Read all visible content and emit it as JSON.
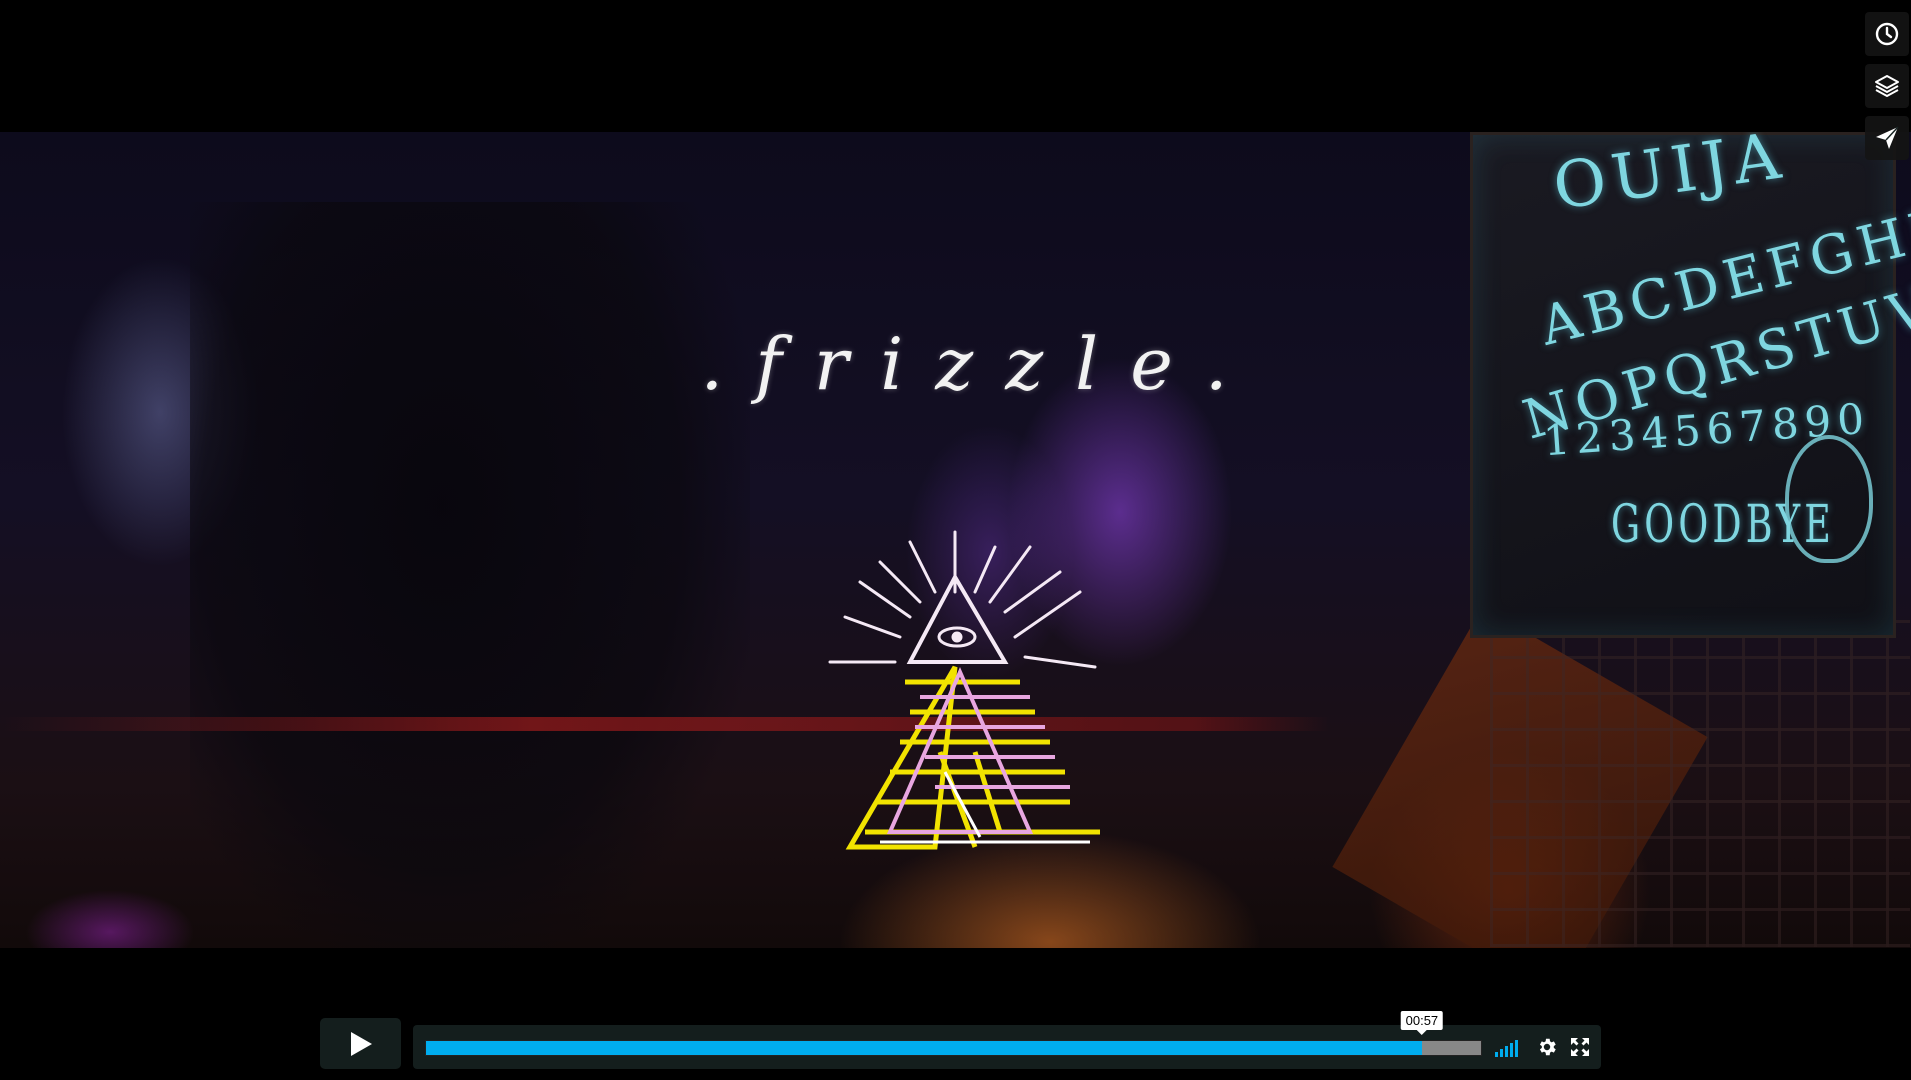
{
  "video": {
    "title_overlay": ".frizzle.",
    "ouija": {
      "line1": "OUIJA",
      "line2": "ABCDEFGHIJKLM",
      "line3": "NOPQRSTUVWXYZ",
      "line4": "1234567890",
      "line5": "GOODBYE"
    }
  },
  "side_buttons": [
    {
      "name": "watch-later",
      "icon": "clock-icon"
    },
    {
      "name": "collections",
      "icon": "layers-icon"
    },
    {
      "name": "share",
      "icon": "paper-plane-icon"
    }
  ],
  "controls": {
    "play_icon": "play-icon",
    "progress_fraction": 0.944,
    "buffered_fraction": 1.0,
    "time_tooltip": "00:57",
    "volume_level": 1.0,
    "volume_icon": "volume-bars-icon",
    "settings_icon": "gear-icon",
    "fullscreen_icon": "fullscreen-icon"
  },
  "colors": {
    "accent": "#00adef",
    "control_bg": "#172322"
  }
}
